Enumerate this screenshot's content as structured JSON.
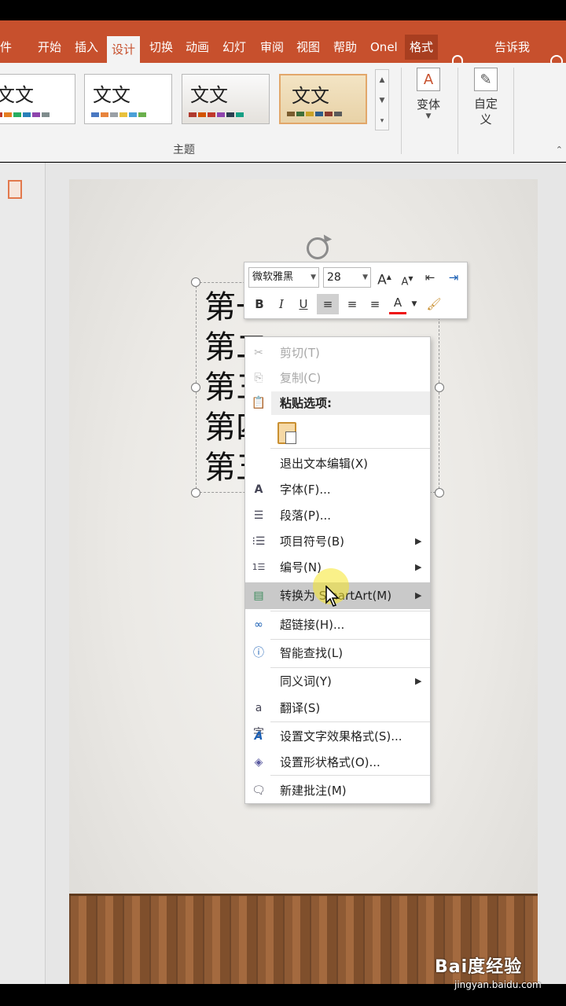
{
  "ribbon": {
    "tabs": [
      {
        "label": "文件",
        "partial": "件"
      },
      {
        "label": "开始"
      },
      {
        "label": "插入"
      },
      {
        "label": "设计"
      },
      {
        "label": "切换"
      },
      {
        "label": "动画"
      },
      {
        "label": "幻灯片放映",
        "partial": "幻灯"
      },
      {
        "label": "审阅"
      },
      {
        "label": "视图"
      },
      {
        "label": "帮助"
      },
      {
        "label": "OneNote",
        "partial": "Onel"
      },
      {
        "label": "格式"
      }
    ],
    "tell_me": "告诉我",
    "active_tab": "设计",
    "themes": [
      {
        "text": "文文",
        "colors": [
          "#c0392b",
          "#e67e22",
          "#27ae60",
          "#2980b9",
          "#8e44ad",
          "#7f8c8d"
        ]
      },
      {
        "text": "文文",
        "colors": [
          "#4a78c2",
          "#e8843c",
          "#9aa0a6",
          "#e8c13c",
          "#4aa0d8",
          "#6ab04c"
        ]
      },
      {
        "text": "文文",
        "colors": [
          "#b03a2e",
          "#d35400",
          "#c0392b",
          "#8e44ad",
          "#2c3e50",
          "#16a085"
        ]
      },
      {
        "text": "文文",
        "colors": [
          "#7a5c2e",
          "#3f6e3a",
          "#c9a227",
          "#2e5d8a",
          "#8a3a2e",
          "#5a5a5a"
        ]
      }
    ],
    "group_label": "主题",
    "variant_label": "变体",
    "customize_label": "自定义"
  },
  "slide": {
    "text_lines": [
      "第一",
      "第二",
      "第三",
      "第四",
      "第五"
    ]
  },
  "mini_toolbar": {
    "font": "微软雅黑",
    "size": "28",
    "grow": "A",
    "shrink": "A",
    "bold": "B",
    "italic": "I",
    "underline": "U",
    "font_color": "A"
  },
  "context_menu": {
    "cut": "剪切(T)",
    "copy": "复制(C)",
    "paste_options": "粘贴选项:",
    "exit_edit": "退出文本编辑(X)",
    "font": "字体(F)...",
    "paragraph": "段落(P)...",
    "bullets": "项目符号(B)",
    "numbering": "编号(N)",
    "convert_smartart": "转换为 SmartArt(M)",
    "hyperlink": "超链接(H)...",
    "smart_lookup": "智能查找(L)",
    "synonyms": "同义词(Y)",
    "translate": "翻译(S)",
    "format_text_effects": "设置文字效果格式(S)...",
    "format_shape": "设置形状格式(O)...",
    "new_comment": "新建批注(M)"
  },
  "watermark": {
    "brand": "Bai度经验",
    "url": "jingyan.baidu.com"
  }
}
